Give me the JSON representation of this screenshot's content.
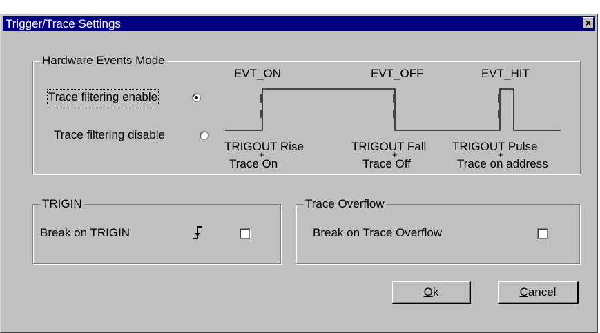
{
  "window": {
    "title": "Trigger/Trace Settings",
    "close_glyph": "×"
  },
  "hw_events": {
    "group_label": "Hardware Events Mode",
    "enable_label": "Trace filtering enable",
    "disable_label": "Trace filtering disable",
    "selected": "enable",
    "diagram": {
      "evt_on": "EVT_ON",
      "evt_off": "EVT_OFF",
      "evt_hit": "EVT_HIT",
      "trigout_rise": "TRIGOUT  Rise",
      "trace_on": "Trace On",
      "trigout_fall": "TRIGOUT Fall",
      "trace_off": "Trace Off",
      "trigout_pulse": "TRIGOUT  Pulse",
      "trace_on_address": "Trace on address",
      "plus_glyph": "+"
    }
  },
  "trigin": {
    "group_label": "TRIGIN",
    "break_label": "Break on TRIGIN",
    "edge_icon": "rising-edge-icon",
    "checked": false
  },
  "trace_overflow": {
    "group_label": "Trace Overflow",
    "break_label": "Break on Trace Overflow",
    "checked": false
  },
  "buttons": {
    "ok_first": "O",
    "ok_rest": "k",
    "cancel_first": "C",
    "cancel_rest": "ancel"
  }
}
